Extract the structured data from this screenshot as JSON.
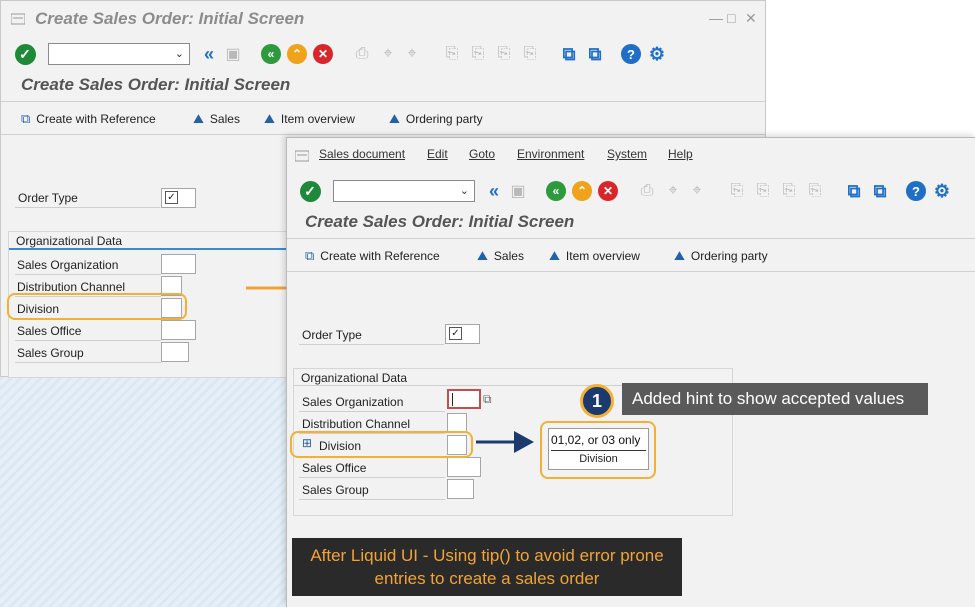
{
  "back_window": {
    "title": "Create Sales Order: Initial Screen",
    "window_controls": [
      "—",
      "□",
      "✕"
    ],
    "screen_title": "Create Sales Order: Initial Screen",
    "appbar": [
      "Create with Reference",
      "Sales",
      "Item overview",
      "Ordering party"
    ],
    "order_type_label": "Order Type",
    "org_group_title": "Organizational Data",
    "org_fields": [
      "Sales Organization",
      "Distribution Channel",
      "Division",
      "Sales Office",
      "Sales Group"
    ]
  },
  "front_window": {
    "menu": [
      "Sales document",
      "Edit",
      "Goto",
      "Environment",
      "System",
      "Help"
    ],
    "screen_title": "Create Sales Order: Initial Screen",
    "appbar": [
      "Create with Reference",
      "Sales",
      "Item overview",
      "Ordering party"
    ],
    "order_type_label": "Order Type",
    "org_group_title": "Organizational Data",
    "org_fields": [
      "Sales Organization",
      "Distribution Channel",
      "Division",
      "Sales Office",
      "Sales Group"
    ]
  },
  "tip": {
    "text": "01,02, or 03 only",
    "label": "Division"
  },
  "callout": {
    "step": "1",
    "text": "Added hint to show accepted values"
  },
  "caption": "After Liquid UI - Using tip() to avoid error prone entries to create a sales order",
  "colors": {
    "highlight": "#f2b135",
    "callout_bg": "#5a5a5a",
    "badge_bg": "#1d3a6e",
    "arrow_orange": "#f2a336",
    "arrow_navy": "#1d3a6e"
  }
}
